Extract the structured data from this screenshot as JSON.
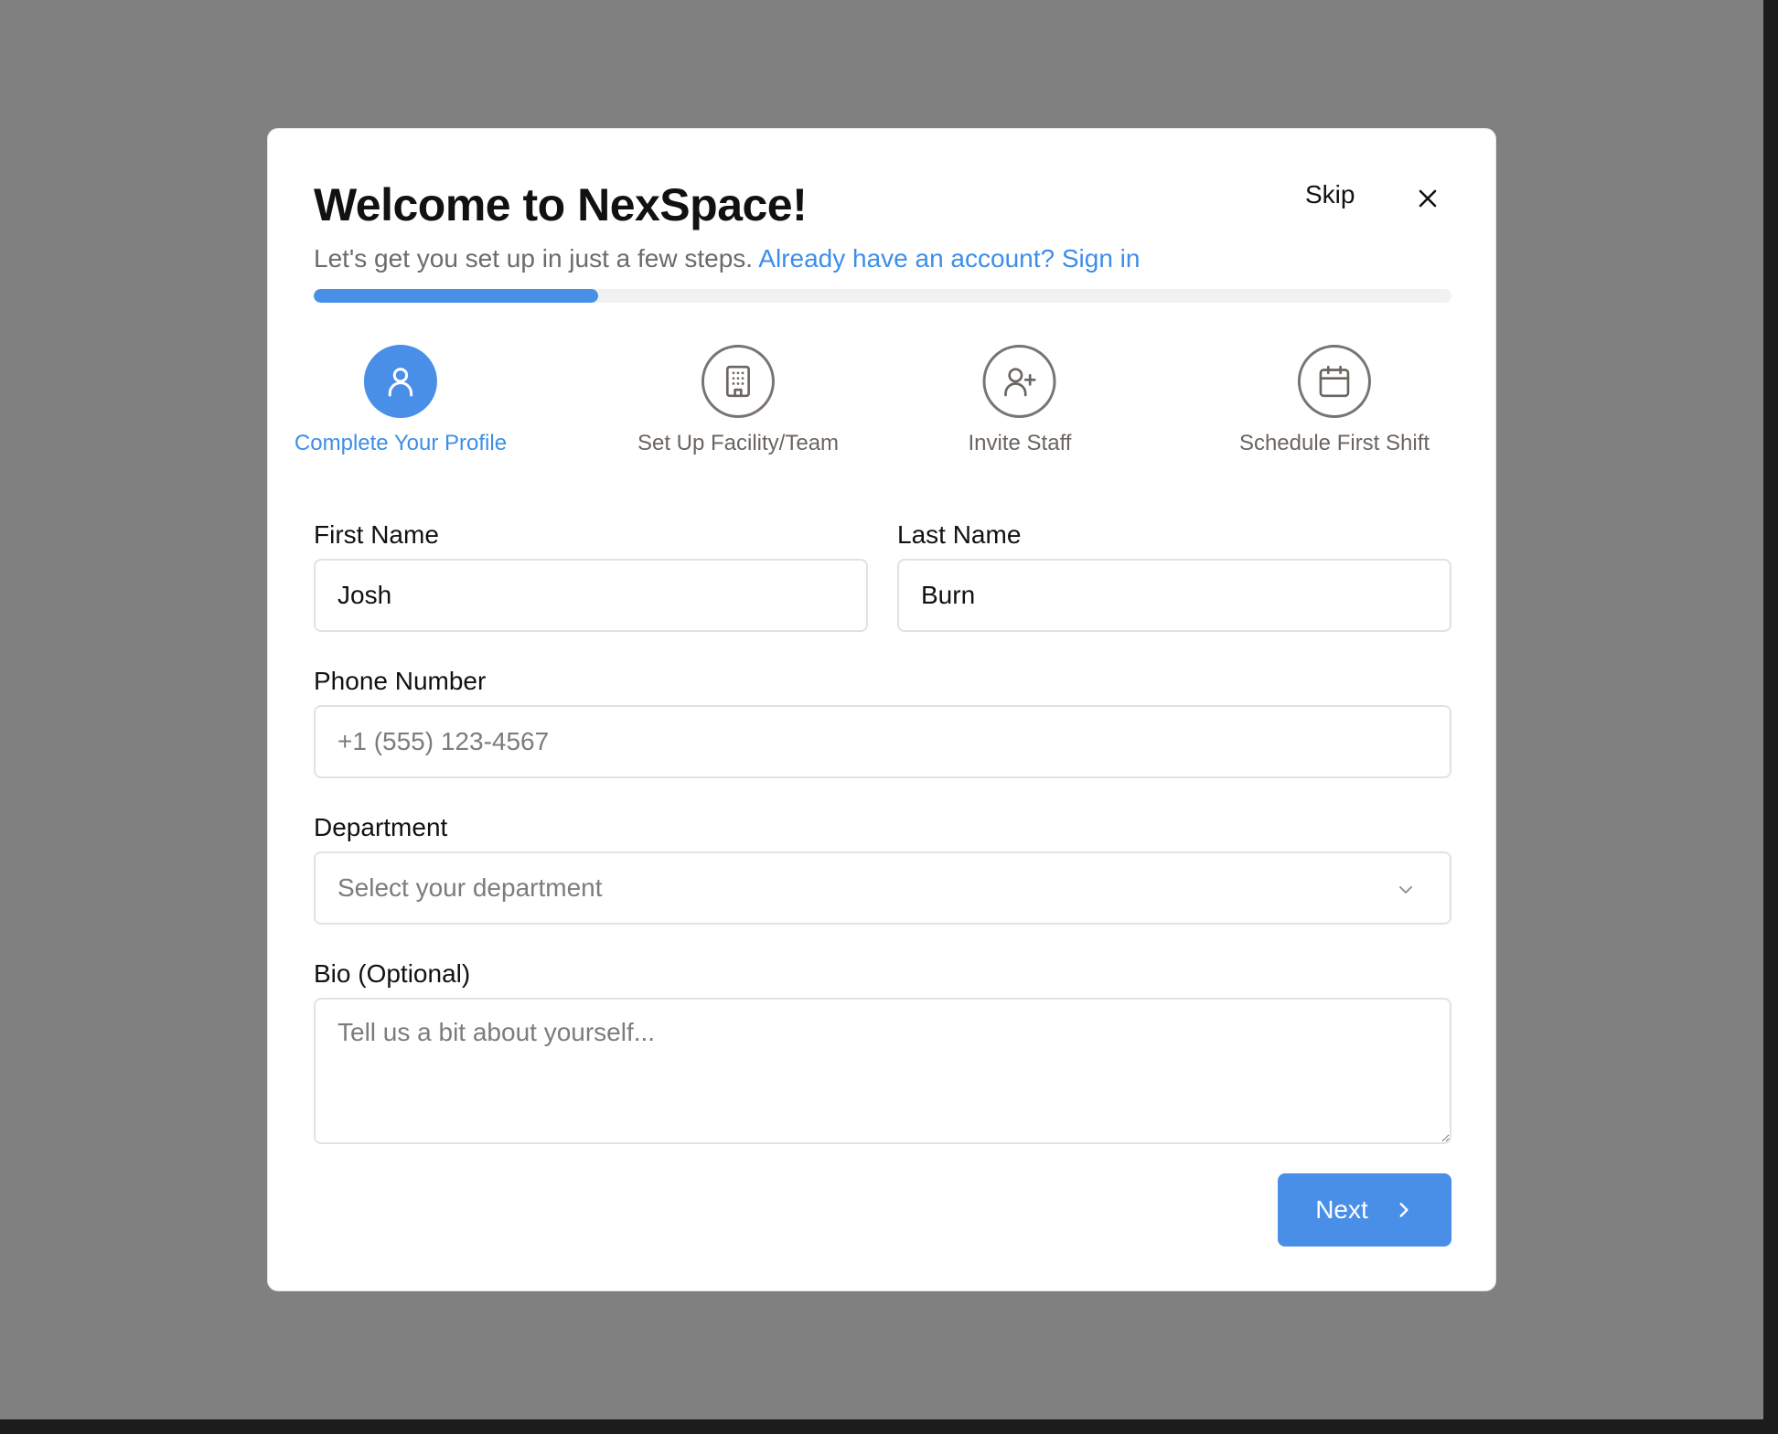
{
  "modal": {
    "title": "Welcome to NexSpace!",
    "subtitle": "Let's get you set up in just a few steps.",
    "signin_link": "Already have an account? Sign in",
    "skip_label": "Skip",
    "close_icon": "close-icon"
  },
  "progress": {
    "value": 0.25,
    "color": "#4a8fe7",
    "track_color": "#f1f1f1"
  },
  "steps": [
    {
      "label": "Complete Your Profile",
      "icon": "user-icon",
      "active": true
    },
    {
      "label": "Set Up Facility/Team",
      "icon": "building-icon",
      "active": false
    },
    {
      "label": "Invite Staff",
      "icon": "user-plus-icon",
      "active": false
    },
    {
      "label": "Schedule First Shift",
      "icon": "calendar-icon",
      "active": false
    }
  ],
  "form": {
    "first_name": {
      "label": "First Name",
      "value": "Josh"
    },
    "last_name": {
      "label": "Last Name",
      "value": "Burn"
    },
    "phone": {
      "label": "Phone Number",
      "value": "",
      "placeholder": "+1 (555) 123-4567"
    },
    "department": {
      "label": "Department",
      "placeholder": "Select your department",
      "icon": "chevron-down-icon"
    },
    "bio": {
      "label": "Bio (Optional)",
      "value": "",
      "placeholder": "Tell us a bit about yourself..."
    }
  },
  "actions": {
    "next_label": "Next",
    "next_icon": "chevron-right-icon"
  },
  "colors": {
    "accent": "#4a8fe7",
    "link": "#3d8ee8",
    "backdrop": "#808080"
  }
}
